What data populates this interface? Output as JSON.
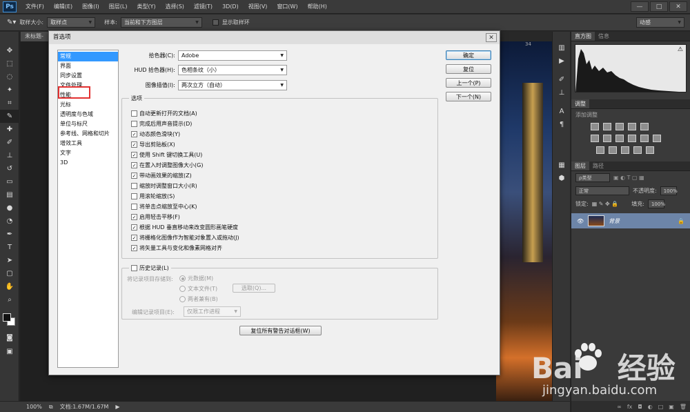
{
  "app": {
    "logo": "Ps",
    "menu": [
      "文件(F)",
      "编辑(E)",
      "图像(I)",
      "图层(L)",
      "类型(Y)",
      "选择(S)",
      "滤镜(T)",
      "3D(D)",
      "视图(V)",
      "窗口(W)",
      "帮助(H)"
    ],
    "window_controls": [
      "—",
      "□",
      "✕"
    ]
  },
  "options_bar": {
    "sample_size_label": "取样大小:",
    "sample_size_value": "取样点",
    "sample_label": "样本:",
    "sample_value": "当前和下方图层",
    "show_ring_label": "显示取样环",
    "workspace": "动感"
  },
  "document": {
    "tab_label": "未标题-",
    "ruler_number": "34"
  },
  "status_bar": {
    "zoom": "100%",
    "doc_info": "文档:1.67M/1.67M"
  },
  "right_panels": {
    "top_tabs": [
      "直方图",
      "信息"
    ],
    "adjust_tab": "调整",
    "adjust_hint": "添加调整",
    "layers_tabs": [
      "图层",
      "路径"
    ],
    "kind_filter": "ρ类型",
    "blend_mode": "正常",
    "opacity_label": "不透明度:",
    "opacity_value": "100%",
    "lock_label": "锁定:",
    "fill_label": "填充:",
    "fill_value": "100%",
    "layer_name": "背景",
    "bottom_icons": [
      "∞",
      "fx",
      "◘",
      "◐",
      "□",
      "▣",
      "🗑"
    ]
  },
  "dialog": {
    "title": "首选项",
    "close": "✕",
    "nav_items": [
      "常规",
      "界面",
      "同步设置",
      "文件处理",
      "性能",
      "光标",
      "透明度与色域",
      "单位与标尺",
      "参考线、网格和切片",
      "增效工具",
      "文字",
      "3D"
    ],
    "selected_nav_index": 0,
    "highlighted_nav_index": 4,
    "highlight_color": "#e23030",
    "color_picker_label": "拾色器(C):",
    "color_picker_value": "Adobe",
    "hud_picker_label": "HUD 拾色器(H):",
    "hud_picker_value": "色相条纹（小）",
    "interpolation_label": "图像插值(I):",
    "interpolation_value": "两次立方（自动）",
    "options_title": "选项",
    "options": [
      {
        "label": "自动更新打开的文档(A)",
        "checked": false
      },
      {
        "label": "完成后用声音提示(D)",
        "checked": false
      },
      {
        "label": "动态颜色滑块(Y)",
        "checked": true
      },
      {
        "label": "导出剪贴板(X)",
        "checked": true
      },
      {
        "label": "使用 Shift 键切换工具(U)",
        "checked": true
      },
      {
        "label": "在置入时调整图像大小(G)",
        "checked": true
      },
      {
        "label": "带动画效果的缩放(Z)",
        "checked": true
      },
      {
        "label": "缩放时调整窗口大小(R)",
        "checked": false
      },
      {
        "label": "用滚轮缩放(S)",
        "checked": false
      },
      {
        "label": "将单击点缩放至中心(K)",
        "checked": false
      },
      {
        "label": "启用轻击平移(F)",
        "checked": true
      },
      {
        "label": "根据 HUD 垂直移动来改变圆形画笔硬度",
        "checked": true
      },
      {
        "label": "将栅格化图像作为智能对象置入或拖动(J)",
        "checked": true
      },
      {
        "label": "将矢量工具与变化和像素网格对齐",
        "checked": true
      }
    ],
    "history": {
      "title": "历史记录(L)",
      "save_to_label": "将记录项目存储到:",
      "radios": [
        "元数据(M)",
        "文本文件(T)",
        "两者兼有(B)"
      ],
      "choose_button": "选取(Q)...",
      "edit_log_label": "编辑记录项目(E):",
      "edit_log_value": "仅限工作进程"
    },
    "buttons": {
      "ok": "确定",
      "reset": "复位",
      "prev": "上一个(P)",
      "next": "下一个(N)"
    },
    "reset_warnings": "复位所有警告对话框(W)"
  },
  "watermark": {
    "brand": "Bai",
    "brand2": "经验",
    "url": "jingyan.baidu.com"
  }
}
